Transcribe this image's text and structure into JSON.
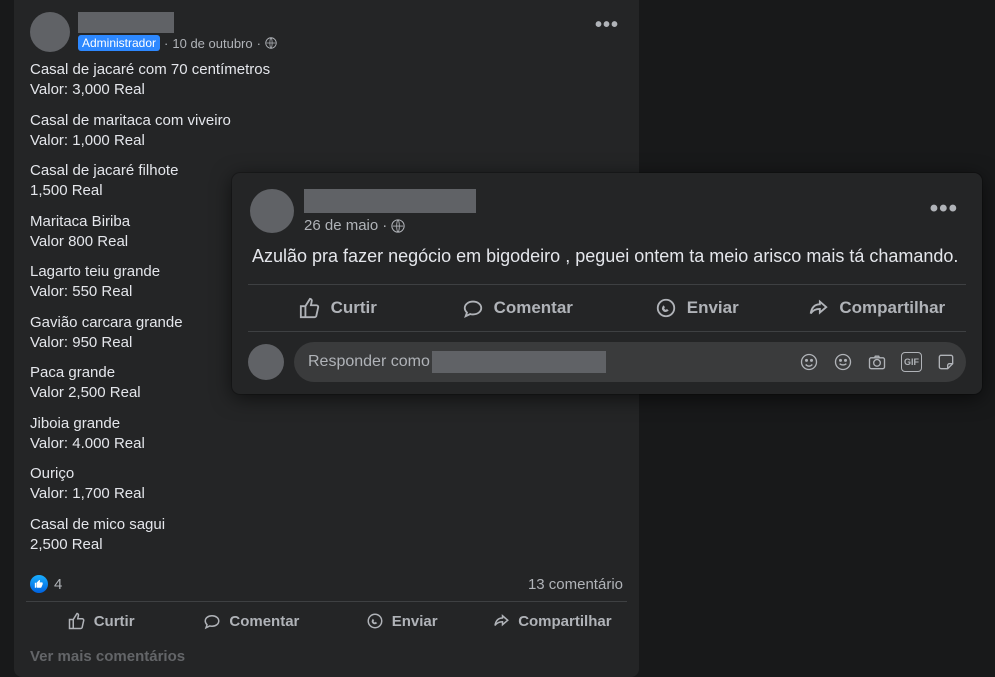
{
  "post1": {
    "admin_badge": "Administrador",
    "date": "10 de outubro",
    "separator": "·",
    "items": [
      {
        "line1": "Casal de jacaré com 70 centímetros",
        "line2": "Valor: 3,000 Real"
      },
      {
        "line1": "Casal de maritaca com viveiro",
        "line2": "Valor: 1,000 Real"
      },
      {
        "line1": "Casal de jacaré filhote",
        "line2": "1,500 Real"
      },
      {
        "line1": "Maritaca Biriba",
        "line2": "Valor 800 Real"
      },
      {
        "line1": "Lagarto teiu grande",
        "line2": "Valor: 550 Real"
      },
      {
        "line1": "Gavião carcara grande",
        "line2": "Valor: 950 Real"
      },
      {
        "line1": "Paca grande",
        "line2": "Valor 2,500 Real"
      },
      {
        "line1": "Jiboia grande",
        "line2": "Valor: 4.000 Real"
      },
      {
        "line1": "Ouriço",
        "line2": "Valor: 1,700 Real"
      },
      {
        "line1": "Casal de mico sagui",
        "line2": "2,500 Real"
      }
    ],
    "like_count": "4",
    "comment_count": "13 comentário",
    "actions": {
      "like": "Curtir",
      "comment": "Comentar",
      "send": "Enviar",
      "share": "Compartilhar"
    },
    "see_more": "Ver mais comentários"
  },
  "post2": {
    "date": "26 de maio",
    "separator": "·",
    "body": "Azulão pra fazer negócio em bigodeiro , peguei ontem ta meio arisco mais tá chamando.",
    "actions": {
      "like": "Curtir",
      "comment": "Comentar",
      "send": "Enviar",
      "share": "Compartilhar"
    },
    "reply_placeholder": "Responder como"
  }
}
